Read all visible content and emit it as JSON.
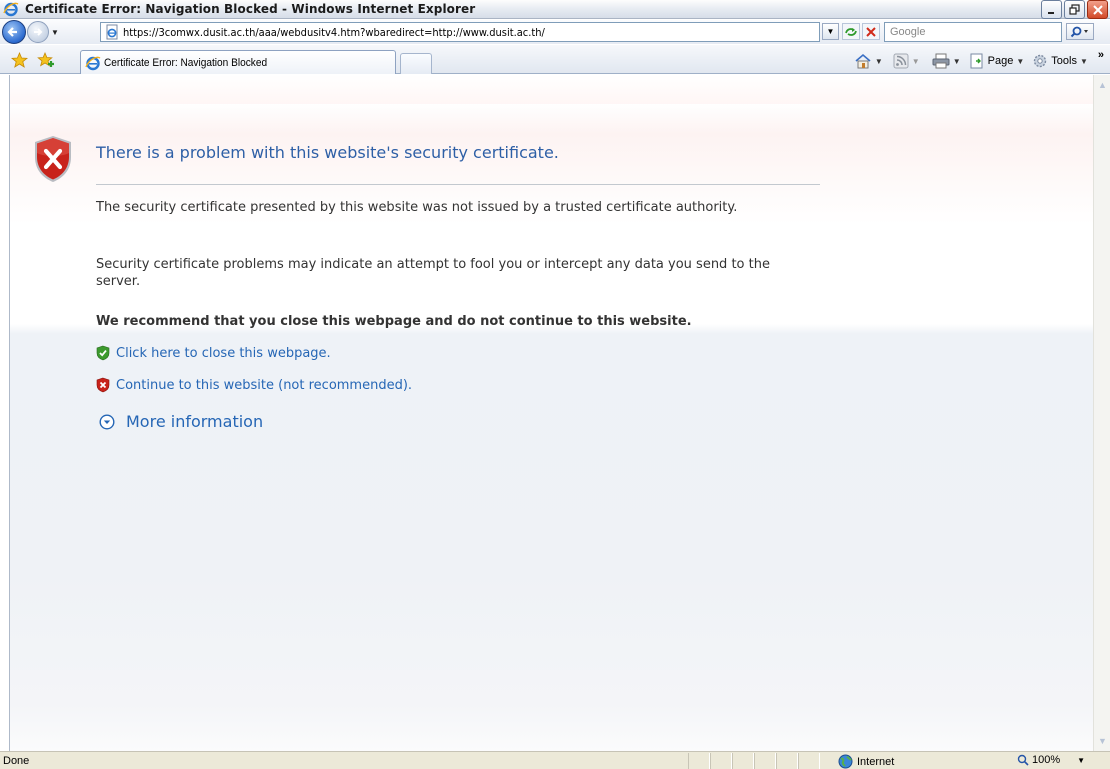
{
  "window": {
    "title": "Certificate Error: Navigation Blocked - Windows Internet Explorer"
  },
  "address_bar": {
    "url": "https://3comwx.dusit.ac.th/aaa/webdusitv4.htm?wbaredirect=http://www.dusit.ac.th/",
    "search_placeholder": "Google"
  },
  "tabs": [
    {
      "label": "Certificate Error: Navigation Blocked",
      "active": true
    }
  ],
  "command_bar": {
    "page_label": "Page",
    "tools_label": "Tools"
  },
  "page": {
    "heading": "There is a problem with this website's security certificate.",
    "paragraph_1": "The security certificate presented by this website was not issued by a trusted certificate authority.",
    "paragraph_2": "Security certificate problems may indicate an attempt to fool you or intercept any data you send to the server.",
    "recommendation": "We recommend that you close this webpage and do not continue to this website.",
    "close_link": "Click here to close this webpage.",
    "continue_link": "Continue to this website (not recommended).",
    "more_info": "More information"
  },
  "status_bar": {
    "status": "Done",
    "zone": "Internet",
    "zoom": "100%"
  },
  "colors": {
    "heading": "#2e5fa6",
    "link": "#2566b5",
    "shield_red": "#c8231b",
    "shield_green": "#3c9a2e"
  }
}
